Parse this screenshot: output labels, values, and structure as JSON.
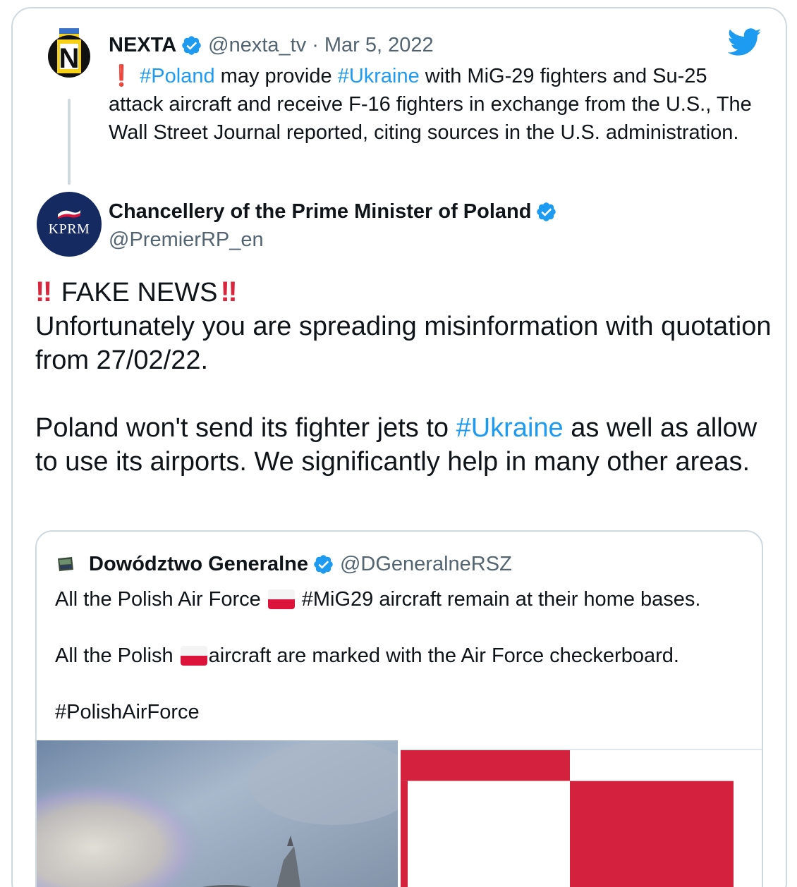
{
  "parent_tweet": {
    "name": "NEXTA",
    "handle": "@nexta_tv",
    "separator": "·",
    "date": "Mar 5, 2022",
    "text_alert": "❗",
    "tag_poland": "#Poland",
    "text_1": " may provide ",
    "tag_ukraine": "#Ukraine",
    "text_2": " with MiG-29 fighters and Su-25 attack aircraft and receive F-16 fighters in exchange from the U.S., The Wall Street Journal reported, citing sources in the U.S. administration.",
    "avatar_letter": "N"
  },
  "main_tweet": {
    "name": "Chancellery of the Prime Minister of Poland",
    "handle": "@PremierRP_en",
    "avatar_text": "KPRM",
    "bang": "‼",
    "headline": " FAKE NEWS",
    "line_1": "Unfortunately you are spreading misinformation with quotation from 27/02/22.",
    "line_2_a": "Poland won't send its fighter jets to ",
    "tag_ukraine": "#Ukraine",
    "line_2_b": " as well as allow to use its airports. We significantly help in many other areas."
  },
  "quoted_tweet": {
    "name": "Dowództwo Generalne",
    "handle": "@DGeneralneRSZ",
    "line_1_a": "All the Polish Air Force",
    "line_1_b": "#MiG29 aircraft remain at their home bases.",
    "line_2_a": "All the Polish",
    "line_2_b": "aircraft are marked with the Air Force checkerboard.",
    "line_3": "#PolishAirForce"
  },
  "icons": {
    "verified": "verified-badge-icon",
    "twitter": "twitter-bird-icon",
    "flag": "poland-flag-icon"
  },
  "colors": {
    "link": "#1d9bf0",
    "verified": "#1d9bf0",
    "muted": "#536471",
    "border": "#cfd9de",
    "polish_red": "#d7263d"
  }
}
